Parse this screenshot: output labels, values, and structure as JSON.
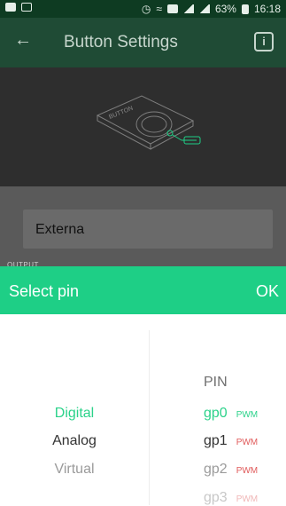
{
  "status": {
    "battery": "63%",
    "time": "16:18"
  },
  "appbar": {
    "title": "Button Settings",
    "info_glyph": "i"
  },
  "illustration": {
    "label": "BUTTON"
  },
  "input": {
    "value": "Externa"
  },
  "section": {
    "output_label": "OUTPUT"
  },
  "picker": {
    "title": "Select pin",
    "ok_label": "OK",
    "pin_header": "PIN",
    "types": [
      {
        "label": "Digital"
      },
      {
        "label": "Analog"
      },
      {
        "label": "Virtual"
      }
    ],
    "pins": [
      {
        "label": "gp0",
        "tag": "PWM"
      },
      {
        "label": "gp1",
        "tag": "PWM"
      },
      {
        "label": "gp2",
        "tag": "PWM"
      },
      {
        "label": "gp3",
        "tag": "PWM"
      }
    ]
  },
  "colors": {
    "accent": "#1ecf86",
    "statusbar": "#0e3b22",
    "appbar": "#1f4b35",
    "overlay": "#5a5a5a",
    "pwm_red": "#e05a5a"
  },
  "icons": {
    "back": "arrow-left-icon",
    "info": "info-icon"
  }
}
